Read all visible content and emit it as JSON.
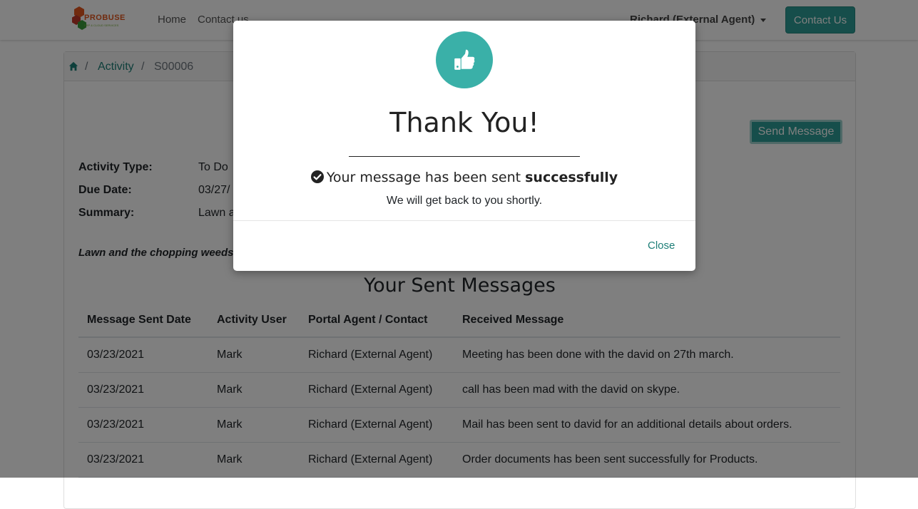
{
  "navbar": {
    "logo_text": "PROBUSE",
    "logo_subtext": "ERP & CLOUD SERVICES",
    "links": [
      "Home",
      "Contact us"
    ],
    "user": "Richard (External Agent)",
    "contact_button": "Contact Us"
  },
  "breadcrumb": {
    "sep": "/",
    "activity": "Activity",
    "current": "S00006"
  },
  "page": {
    "send_message_button": "Send Message",
    "activity_type_label": "Activity Type:",
    "activity_type_value": "To Do",
    "due_date_label": "Due Date:",
    "due_date_value": "03/27/",
    "summary_label": "Summary:",
    "summary_value": "Lawn a",
    "description": "Lawn and the chopping weeds",
    "section_title": "Your Sent Messages"
  },
  "table": {
    "headers": [
      "Message Sent Date",
      "Activity User",
      "Portal Agent / Contact",
      "Received Message"
    ],
    "rows": [
      [
        "03/23/2021",
        "Mark",
        "Richard (External Agent)",
        "Meeting has been done with the david on 27th march."
      ],
      [
        "03/23/2021",
        "Mark",
        "Richard (External Agent)",
        "call has been mad with the david on skype."
      ],
      [
        "03/23/2021",
        "Mark",
        "Richard (External Agent)",
        "Mail has been sent to david for an additional details about orders."
      ],
      [
        "03/23/2021",
        "Mark",
        "Richard (External Agent)",
        "Order documents has been sent successfully for Products."
      ]
    ]
  },
  "modal": {
    "title": "Thank You!",
    "message_prefix": "Your message has been sent ",
    "message_bold": "successfully",
    "subtext": "We will get back to you shortly.",
    "close_button": "Close"
  },
  "colors": {
    "accent": "#2d9d96",
    "link": "#1d7e77",
    "thumb_circle": "#3ab0a8",
    "backdrop": "rgba(0,0,0,0.5)"
  },
  "icons": {
    "home": "home-icon",
    "thumb": "thumbs-up-icon",
    "check": "check-circle-icon"
  }
}
